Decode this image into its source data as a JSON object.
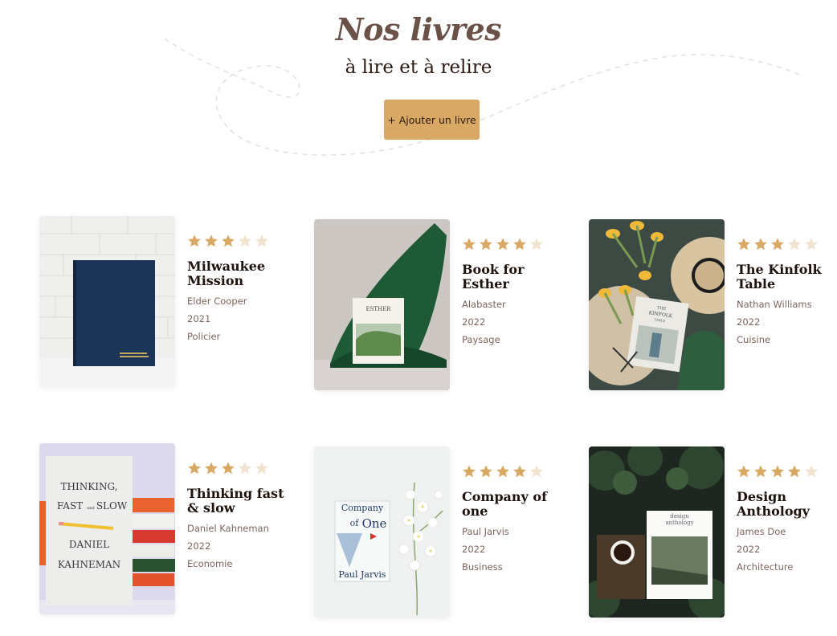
{
  "header": {
    "title": "Nos livres",
    "subtitle": "à lire et à relire",
    "add_button_label": "+ Ajouter un livre"
  },
  "colors": {
    "accent": "#d9a864",
    "star_filled": "#d9a864",
    "star_empty": "#f1e3cf",
    "title_color": "#6b5248"
  },
  "books": [
    {
      "title": "Milwaukee Mission",
      "author": "Elder Cooper",
      "year": "2021",
      "genre": "Policier",
      "rating": 3,
      "max_rating": 5
    },
    {
      "title": "Book for Esther",
      "author": "Alabaster",
      "year": "2022",
      "genre": "Paysage",
      "rating": 4,
      "max_rating": 5
    },
    {
      "title": "The Kinfolk Table",
      "author": "Nathan Williams",
      "year": "2022",
      "genre": "Cuisine",
      "rating": 3,
      "max_rating": 5
    },
    {
      "title": "Thinking fast & slow",
      "author": "Daniel Kahneman",
      "year": "2022",
      "genre": "Economie",
      "rating": 3,
      "max_rating": 5
    },
    {
      "title": "Company of one",
      "author": "Paul Jarvis",
      "year": "2022",
      "genre": "Business",
      "rating": 4,
      "max_rating": 5
    },
    {
      "title": "Design Anthology",
      "author": "James Doe",
      "year": "2022",
      "genre": "Architecture",
      "rating": 4,
      "max_rating": 5
    }
  ],
  "cover_texts": {
    "esther": "ESTHER",
    "kinfolk_1": "THE",
    "kinfolk_2": "KINFOLK",
    "kinfolk_3": "TABLE",
    "thinking_1": "THINKING,",
    "thinking_2": "FAST",
    "thinking_3": "and",
    "thinking_4": "SLOW",
    "thinking_5": "DANIEL",
    "thinking_6": "KAHNEMAN",
    "company_1": "Company",
    "company_2": "of",
    "company_3": "One",
    "company_4": "Paul Jarvis",
    "design_1": "design",
    "design_2": "anthology"
  }
}
